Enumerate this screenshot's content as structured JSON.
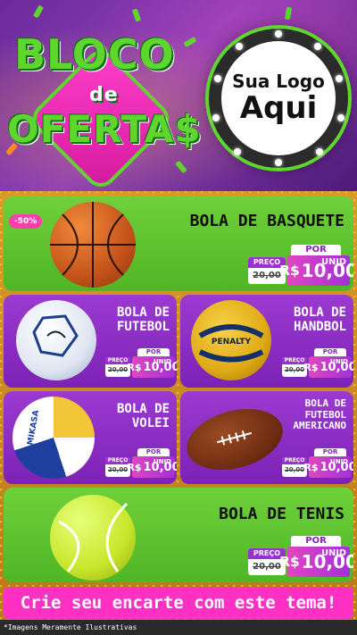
{
  "header": {
    "title_line1": "BLOCO",
    "title_line2": "de",
    "title_line3": "OFERTA$",
    "logo_line1": "Sua Logo",
    "logo_line2": "Aqui"
  },
  "discount_badge": "-50%",
  "price_labels": {
    "por": "POR",
    "preco": "PREÇO",
    "currency": "R$",
    "unit": "UNID"
  },
  "products": [
    {
      "name": "BOLA DE BASQUETE",
      "old_price": "20,00",
      "price": "10,00"
    },
    {
      "name_line1": "BOLA DE",
      "name_line2": "FUTEBOL",
      "old_price": "20,00",
      "price": "10,00"
    },
    {
      "name_line1": "BOLA DE",
      "name_line2": "HANDBOL",
      "old_price": "20,00",
      "price": "10,00"
    },
    {
      "name_line1": "BOLA DE",
      "name_line2": "VOLEI",
      "old_price": "20,00",
      "price": "10,00"
    },
    {
      "name_line1": "BOLA DE",
      "name_line2": "FUTEBOL",
      "name_line3": "AMERICANO",
      "old_price": "20,00",
      "price": "10,00"
    },
    {
      "name": "BOLA DE TENIS",
      "old_price": "20,00",
      "price": "10,00"
    }
  ],
  "ball_brands": {
    "handbol": "PENALTY",
    "volei": "MIKASA"
  },
  "cta": "Crie seu encarte com este tema!",
  "disclaimer": "*Imagens Meramente Ilustrativas",
  "colors": {
    "green": "#5ed62e",
    "purple": "#8e2fc4",
    "pink": "#ff31c4"
  }
}
